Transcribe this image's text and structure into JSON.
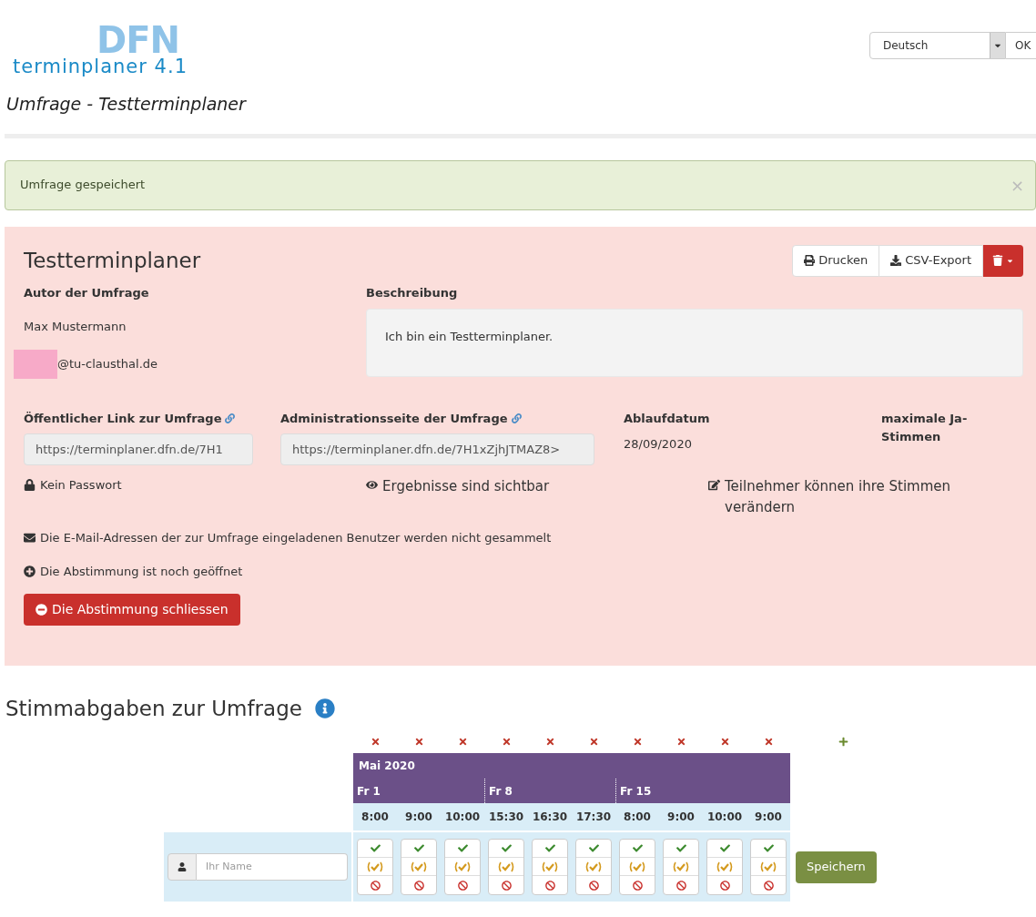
{
  "logo": {
    "mark": "DFN",
    "name": "terminplaner 4.1"
  },
  "language": {
    "value": "Deutsch",
    "button": "OK"
  },
  "page_title": "Umfrage - Testterminplaner",
  "alert": {
    "message": "Umfrage gespeichert",
    "close": "×"
  },
  "poll": {
    "title": "Testterminplaner",
    "actions": [
      {
        "kind": "print",
        "label": "Drucken"
      },
      {
        "kind": "export",
        "label": "CSV-Export"
      },
      {
        "kind": "delete"
      }
    ],
    "author": {
      "label": "Autor der Umfrage",
      "name": "Max Mustermann",
      "email": "@tu-clausthal.de"
    },
    "description": {
      "label": "Beschreibung",
      "text": "Ich bin ein Testterminplaner."
    },
    "public_link": {
      "label": "Öffentlicher Link zur Umfrage",
      "value": "https://terminplaner.dfn.de/7H1"
    },
    "admin_link": {
      "label": "Administrationsseite der Umfrage",
      "value": "https://terminplaner.dfn.de/7H1xZjhJTMAZ8>"
    },
    "expiry": {
      "label": "Ablaufdatum",
      "value": "28/09/2020"
    },
    "max_yes": {
      "label": "maximale Ja-Stimmen"
    },
    "flags": [
      {
        "kind": "lock",
        "text": "Kein Passwort"
      },
      {
        "kind": "eye",
        "text": "Ergebnisse sind sichtbar"
      },
      {
        "kind": "edit",
        "text": "Teilnehmer können ihre Stimmen verändern"
      }
    ],
    "notes": [
      {
        "kind": "envelope",
        "text": "Die E-Mail-Adressen der zur Umfrage eingeladenen Benutzer werden nicht gesammelt"
      },
      {
        "kind": "open",
        "text": "Die Abstimmung ist noch geöffnet"
      }
    ],
    "close_button": "Die Abstimmung schliessen"
  },
  "votes": {
    "title": "Stimmabgaben zur Umfrage",
    "month": "Mai 2020",
    "days": [
      {
        "label": "Fr 1",
        "times": [
          "8:00",
          "9:00",
          "10:00"
        ]
      },
      {
        "label": "Fr 8",
        "times": [
          "15:30",
          "16:30",
          "17:30"
        ]
      },
      {
        "label": "Fr 15",
        "times": [
          "8:00",
          "9:00",
          "10:00",
          "9:00"
        ]
      }
    ],
    "name_placeholder": "Ihr Name",
    "save": "Speichern"
  }
}
